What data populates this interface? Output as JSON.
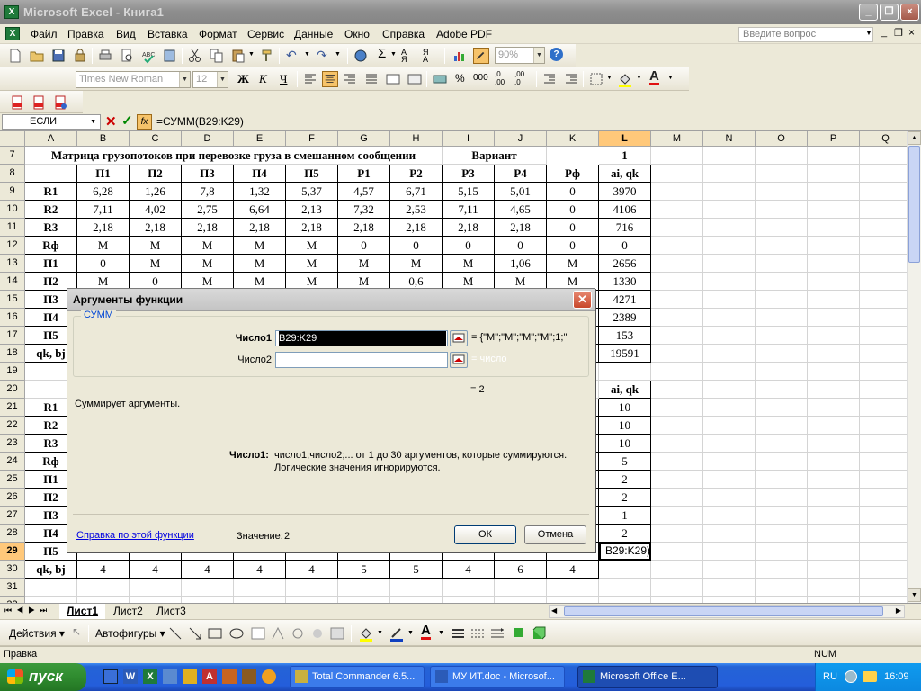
{
  "window": {
    "title": "Microsoft Excel - Книга1",
    "app_icon": "X"
  },
  "menu": [
    "Файл",
    "Правка",
    "Вид",
    "Вставка",
    "Формат",
    "Сервис",
    "Данные",
    "Окно",
    "Справка",
    "Adobe PDF"
  ],
  "ask_placeholder": "Введите вопрос",
  "toolbar": {
    "zoom": "90%",
    "font": "Times New Roman",
    "size": "12"
  },
  "formula": {
    "namebox": "ЕСЛИ",
    "content": "=СУММ(B29:K29)",
    "fx": "fx"
  },
  "columns": [
    "A",
    "B",
    "C",
    "D",
    "E",
    "F",
    "G",
    "H",
    "I",
    "J",
    "K",
    "L",
    "M",
    "N",
    "O",
    "P",
    "Q"
  ],
  "rows": [
    {
      "n": "7",
      "cells": {
        "A": "Матрица грузопотоков при перевозке груза в смешанном сообщении",
        "I": "Вариант",
        "L": "1"
      }
    },
    {
      "n": "8",
      "cells": {
        "B": "П1",
        "C": "П2",
        "D": "П3",
        "E": "П4",
        "F": "П5",
        "G": "Р1",
        "H": "Р2",
        "I": "Р3",
        "J": "Р4",
        "K": "Рф",
        "L": "ai, qk"
      }
    },
    {
      "n": "9",
      "cells": {
        "A": "R1",
        "B": "6,28",
        "C": "1,26",
        "D": "7,8",
        "E": "1,32",
        "F": "5,37",
        "G": "4,57",
        "H": "6,71",
        "I": "5,15",
        "J": "5,01",
        "K": "0",
        "L": "3970"
      }
    },
    {
      "n": "10",
      "cells": {
        "A": "R2",
        "B": "7,11",
        "C": "4,02",
        "D": "2,75",
        "E": "6,64",
        "F": "2,13",
        "G": "7,32",
        "H": "2,53",
        "I": "7,11",
        "J": "4,65",
        "K": "0",
        "L": "4106"
      }
    },
    {
      "n": "11",
      "cells": {
        "A": "R3",
        "B": "2,18",
        "C": "2,18",
        "D": "2,18",
        "E": "2,18",
        "F": "2,18",
        "G": "2,18",
        "H": "2,18",
        "I": "2,18",
        "J": "2,18",
        "K": "0",
        "L": "716"
      }
    },
    {
      "n": "12",
      "cells": {
        "A": "Rф",
        "B": "M",
        "C": "M",
        "D": "M",
        "E": "M",
        "F": "M",
        "G": "0",
        "H": "0",
        "I": "0",
        "J": "0",
        "K": "0",
        "L": "0"
      }
    },
    {
      "n": "13",
      "cells": {
        "A": "П1",
        "B": "0",
        "C": "M",
        "D": "M",
        "E": "M",
        "F": "M",
        "G": "M",
        "H": "M",
        "I": "M",
        "J": "1,06",
        "K": "M",
        "L": "2656"
      }
    },
    {
      "n": "14",
      "cells": {
        "A": "П2",
        "B": "M",
        "C": "0",
        "D": "M",
        "E": "M",
        "F": "M",
        "G": "M",
        "H": "0,6",
        "I": "M",
        "J": "M",
        "K": "M",
        "L": "1330"
      }
    },
    {
      "n": "15",
      "cells": {
        "A": "П3",
        "L": "4271"
      }
    },
    {
      "n": "16",
      "cells": {
        "A": "П4",
        "L": "2389"
      }
    },
    {
      "n": "17",
      "cells": {
        "A": "П5",
        "L": "153"
      }
    },
    {
      "n": "18",
      "cells": {
        "A": "qk, bj",
        "L": "19591"
      }
    },
    {
      "n": "19",
      "cells": {}
    },
    {
      "n": "20",
      "cells": {
        "L": "ai, qk"
      }
    },
    {
      "n": "21",
      "cells": {
        "A": "R1",
        "L": "10"
      }
    },
    {
      "n": "22",
      "cells": {
        "A": "R2",
        "L": "10"
      }
    },
    {
      "n": "23",
      "cells": {
        "A": "R3",
        "L": "10"
      }
    },
    {
      "n": "24",
      "cells": {
        "A": "Rф",
        "L": "5"
      }
    },
    {
      "n": "25",
      "cells": {
        "A": "П1",
        "L": "2"
      }
    },
    {
      "n": "26",
      "cells": {
        "A": "П2",
        "L": "2"
      }
    },
    {
      "n": "27",
      "cells": {
        "A": "П3",
        "L": "1"
      }
    },
    {
      "n": "28",
      "cells": {
        "A": "П4",
        "L": "2"
      }
    },
    {
      "n": "29",
      "cells": {
        "A": "П5",
        "L": "B29:K29)"
      }
    },
    {
      "n": "30",
      "cells": {
        "A": "qk, bj",
        "B": "4",
        "C": "4",
        "D": "4",
        "E": "4",
        "F": "4",
        "G": "5",
        "H": "5",
        "I": "4",
        "J": "6",
        "K": "4"
      }
    },
    {
      "n": "31",
      "cells": {}
    },
    {
      "n": "32",
      "cells": {}
    }
  ],
  "sheets": [
    "Лист1",
    "Лист2",
    "Лист3"
  ],
  "drawbar": {
    "actions": "Действия",
    "autoshapes": "Автофигуры"
  },
  "status": {
    "left": "Правка",
    "num": "NUM"
  },
  "dialog": {
    "title": "Аргументы функции",
    "func": "СУММ",
    "arg1_label": "Число1",
    "arg1_value": "B29:K29",
    "arg1_result": "= {\"M\";\"M\";\"M\";\"M\";1;\"",
    "arg2_label": "Число2",
    "arg2_result": "= число",
    "total": "= 2",
    "desc": "Суммирует аргументы.",
    "help_label": "Число1:",
    "help_text1": "число1;число2;... от 1 до 30 аргументов, которые суммируются.",
    "help_text2": "Логические значения игнорируются.",
    "help_link": "Справка по этой функции",
    "value_label": "Значение:",
    "value": "2",
    "ok": "ОК",
    "cancel": "Отмена"
  },
  "taskbar": {
    "start": "пуск",
    "tasks": [
      "Total Commander 6.5...",
      "МУ ИТ.doc - Microsof...",
      "Microsoft Office E..."
    ],
    "lang": "RU",
    "clock": "16:09"
  }
}
